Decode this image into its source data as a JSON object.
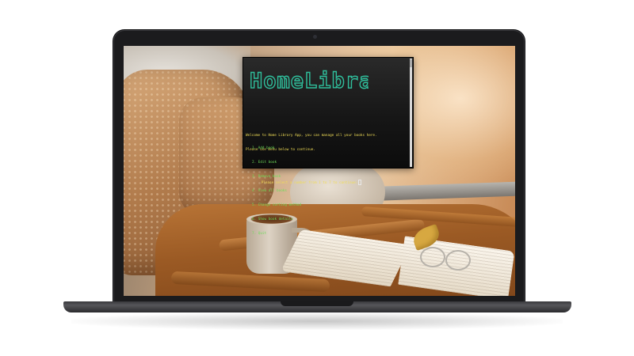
{
  "terminal": {
    "banner": "HomeLibrary",
    "intro_line1": "Welcome to Home Library App, you can manage all your books here.",
    "intro_line2": "Please use menu below to continue.",
    "menu_items": [
      "1. Add book",
      "2. Edit book",
      "3. Remove book",
      "4. View all books",
      "5. Change sorting method",
      "6. Show book details",
      "7. Quit"
    ],
    "prompt": "Please select a number from 1 to 7 to continue:"
  },
  "colors": {
    "banner": "#2fbf9c",
    "intro_text": "#f0dd56",
    "menu_text": "#6fdc5a",
    "terminal_bg": "#161616",
    "laptop_bezel": "#1b1b1d"
  },
  "icons": {
    "cursor": "text-cursor-block"
  }
}
